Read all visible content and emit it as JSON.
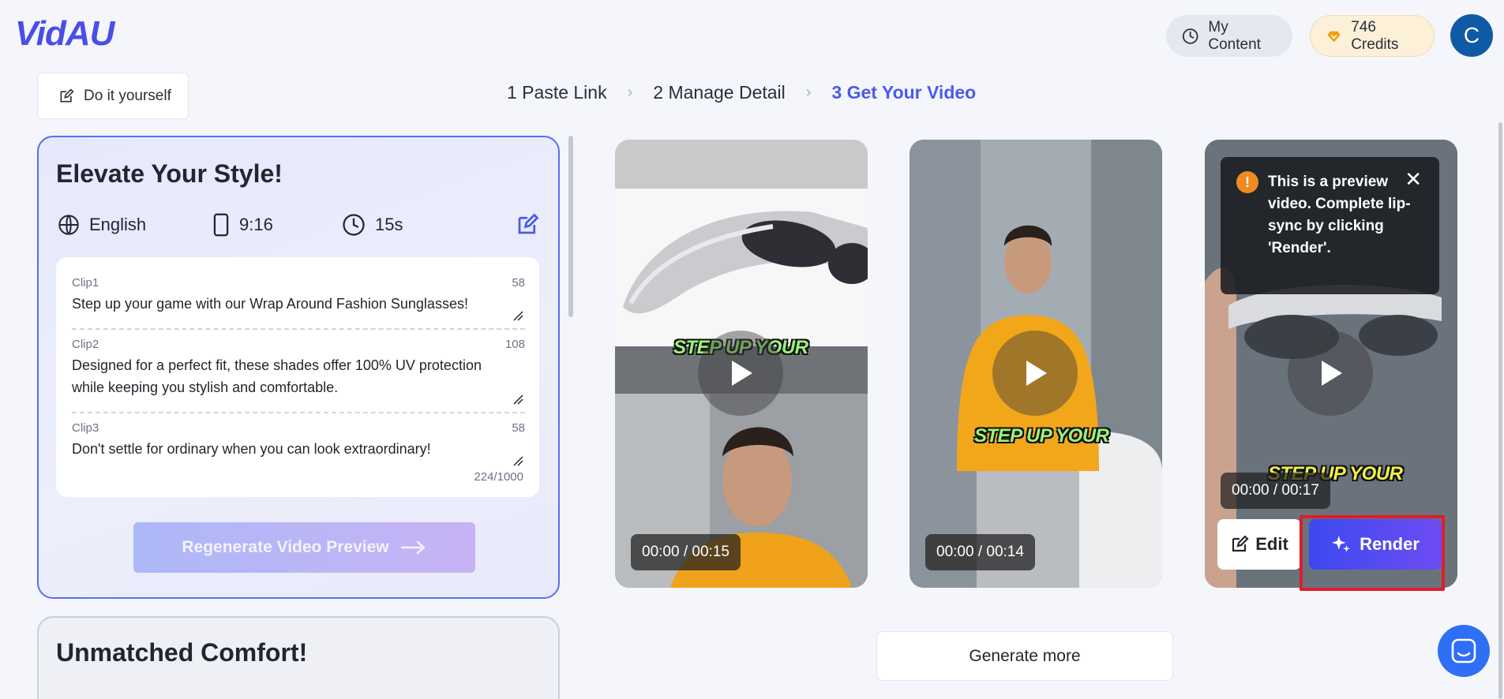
{
  "header": {
    "logo": "VidAU",
    "my_content_label": "My Content",
    "credits_label": "746 Credits",
    "avatar_initial": "C"
  },
  "toolbar": {
    "diy_label": "Do it yourself"
  },
  "steps": [
    {
      "label": "1 Paste Link",
      "active": false
    },
    {
      "label": "2 Manage Detail",
      "active": false
    },
    {
      "label": "3 Get Your Video",
      "active": true
    }
  ],
  "script_card": {
    "title": "Elevate Your Style!",
    "language": "English",
    "ratio": "9:16",
    "duration": "15s",
    "clips": [
      {
        "label": "Clip1",
        "count": "58",
        "text": "Step up your game with our Wrap Around Fashion Sunglasses!"
      },
      {
        "label": "Clip2",
        "count": "108",
        "text": "Designed for a perfect fit, these shades offer 100% UV protection while keeping you stylish and comfortable."
      },
      {
        "label": "Clip3",
        "count": "58",
        "text": "Don't settle for ordinary when you can look extraordinary!"
      }
    ],
    "char_total": "224/1000",
    "regen_label": "Regenerate Video Preview"
  },
  "script_card_2": {
    "title": "Unmatched Comfort!"
  },
  "videos": [
    {
      "timecode": "00:00 / 00:15",
      "caption": "STEP UP YOUR"
    },
    {
      "timecode": "00:00 / 00:14",
      "caption": "STEP UP YOUR"
    },
    {
      "timecode": "00:00 / 00:17",
      "caption": "STEP UP YOUR"
    }
  ],
  "preview_tip": {
    "text": "This is a preview video. Complete lip-sync by clicking 'Render'."
  },
  "actions": {
    "edit_label": "Edit",
    "render_label": "Render"
  },
  "generate_more_label": "Generate more",
  "colors": {
    "accent": "#4a5ce8",
    "render_start": "#3c49ef",
    "render_end": "#6d4cf2",
    "highlight": "#e01c2c"
  },
  "icons": [
    "clock-icon",
    "diamond-icon",
    "edit-icon",
    "globe-icon",
    "phone-icon",
    "play-icon",
    "alert-icon",
    "close-icon",
    "sparkle-icon",
    "arrow-right-icon",
    "chat-icon"
  ]
}
